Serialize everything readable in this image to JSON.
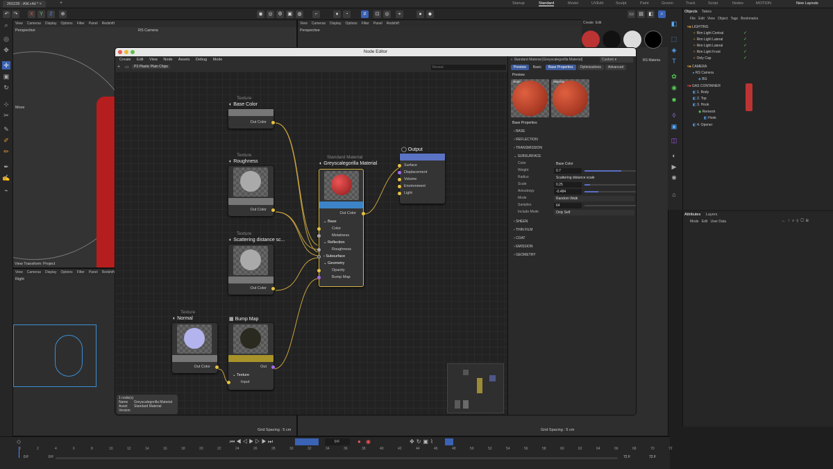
{
  "app": {
    "file_tabs": [
      "260228 - AM.c4d *"
    ],
    "layouts": [
      "Startup",
      "Standard",
      "Model",
      "UVEdit",
      "Sculpt",
      "Paint",
      "Groom",
      "Track",
      "Script",
      "Nodes",
      "MOTION"
    ],
    "active_layout": "Standard",
    "new_layouts": "New Layouts"
  },
  "axes": {
    "x": "X",
    "y": "Y",
    "z": "Z"
  },
  "viewports": {
    "menu": [
      "View",
      "Cameras",
      "Display",
      "Options",
      "Filter",
      "Panel",
      "Redshift"
    ],
    "topleft": {
      "label": "Perspective",
      "camera": "RS Camera",
      "move": "Move",
      "view_transform": "View Transform: Project"
    },
    "bottomleft": {
      "label": "Right"
    },
    "topright": {
      "label": "Perspective"
    },
    "grid_spacing": "Grid Spacing : 5 cm",
    "grid_spacing2": "Grid Spacing : 5 cm"
  },
  "node_editor": {
    "title": "Node Editor",
    "menu": [
      "Create",
      "Edit",
      "View",
      "Node",
      "Assets",
      "Debug",
      "Mode"
    ],
    "breadcrumb": "P3 Plastic Plain Chips",
    "search_placeholder": "Reveal",
    "nodes": {
      "base_color": {
        "category": "Texture",
        "name": "Base Color",
        "port": "Out Color"
      },
      "roughness": {
        "category": "Texture",
        "name": "Roughness",
        "port": "Out Color"
      },
      "scattering": {
        "category": "Texture",
        "name": "Scattering distance sc...",
        "port": "Out Color"
      },
      "normal": {
        "category": "Texture",
        "name": "Normal",
        "port": "Out Color"
      },
      "bump": {
        "name": "Bump Map",
        "port": "Out",
        "group": "Texture",
        "input": "Input"
      },
      "material": {
        "category": "Standard Material",
        "name": "Greyscalegorilla Material",
        "port": "Out Color",
        "inputs": [
          "Base",
          "Color",
          "Metalness",
          "Reflection",
          "Roughness",
          "Subsurface",
          "Geometry",
          "Opacity",
          "Bump Map"
        ]
      },
      "output": {
        "name": "Output",
        "inputs": [
          "Surface",
          "Displacement",
          "Volume",
          "Environment",
          "Light"
        ]
      }
    },
    "info": {
      "count": "1 node(s)",
      "name_label": "Name",
      "name": "Greyscalegorilla Material",
      "asset_label": "Asset",
      "asset": "Standard Material",
      "version_label": "Version"
    },
    "props": {
      "header": "Standard Material [Greyscalegorilla Material]",
      "preset": "Custom",
      "tabs": [
        "Preview",
        "Basic",
        "Base Properties",
        "Optimizations",
        "Advanced"
      ],
      "preview_label": "Preview",
      "thumb_labels": [
        "Node",
        "Material"
      ],
      "section": "Base Properties",
      "collapsed": [
        "BASE",
        "REFLECTION",
        "TRANSMISSION"
      ],
      "subsurface": "SUBSURFACE",
      "rows": [
        {
          "label": "Color",
          "value": "Base Color"
        },
        {
          "label": "Weight",
          "value": "0.7",
          "slider": 0.7
        },
        {
          "label": "Radius",
          "value": "Scattering distance scale"
        },
        {
          "label": "Scale",
          "value": "0.25",
          "slider": 0.1
        },
        {
          "label": "Anisotropy",
          "value": "-0.484",
          "slider": 0.26
        },
        {
          "label": "Mode",
          "value": "Random Walk"
        },
        {
          "label": "Samples",
          "value": "64",
          "slider": 0.0
        },
        {
          "label": "Include Mode",
          "value": "Only Self"
        }
      ],
      "more": [
        "SHEEN",
        "THIN FILM",
        "COAT",
        "EMISSION",
        "GEOMETRY"
      ]
    }
  },
  "objects": {
    "tabs": [
      "Objects",
      "Takes"
    ],
    "menu": [
      "File",
      "Edit",
      "View",
      "Object",
      "Tags",
      "Bookmarks"
    ],
    "items": [
      "LIGHTING",
      "Rim Light Central",
      "Rim Light Lateral",
      "Rim Light Lateral",
      "Rim Light Front",
      "Only Cap",
      "CAMERA",
      "RS Camera",
      "BG",
      "GAS CONTAINER",
      "1. Body",
      "2. Top",
      "3. Hook",
      "Remesh",
      "Hook",
      "4. Opener"
    ]
  },
  "material_bar": {
    "label": "RS Materia"
  },
  "attributes": {
    "tabs": [
      "Attributes",
      "Layers"
    ],
    "menu": [
      "Mode",
      "Edit",
      "User Data"
    ]
  },
  "timeline": {
    "ticks": [
      "0",
      "2",
      "4",
      "6",
      "8",
      "10",
      "12",
      "14",
      "16",
      "18",
      "20",
      "22",
      "24",
      "26",
      "28",
      "30",
      "32",
      "34",
      "36",
      "38",
      "40",
      "42",
      "44",
      "46",
      "48",
      "50",
      "52",
      "54",
      "56",
      "58",
      "60",
      "62",
      "64",
      "66",
      "68",
      "70",
      "72"
    ],
    "start": "0 F",
    "start2": "0 F",
    "current": "0 F",
    "end": "72 F",
    "end2": "72 F"
  }
}
